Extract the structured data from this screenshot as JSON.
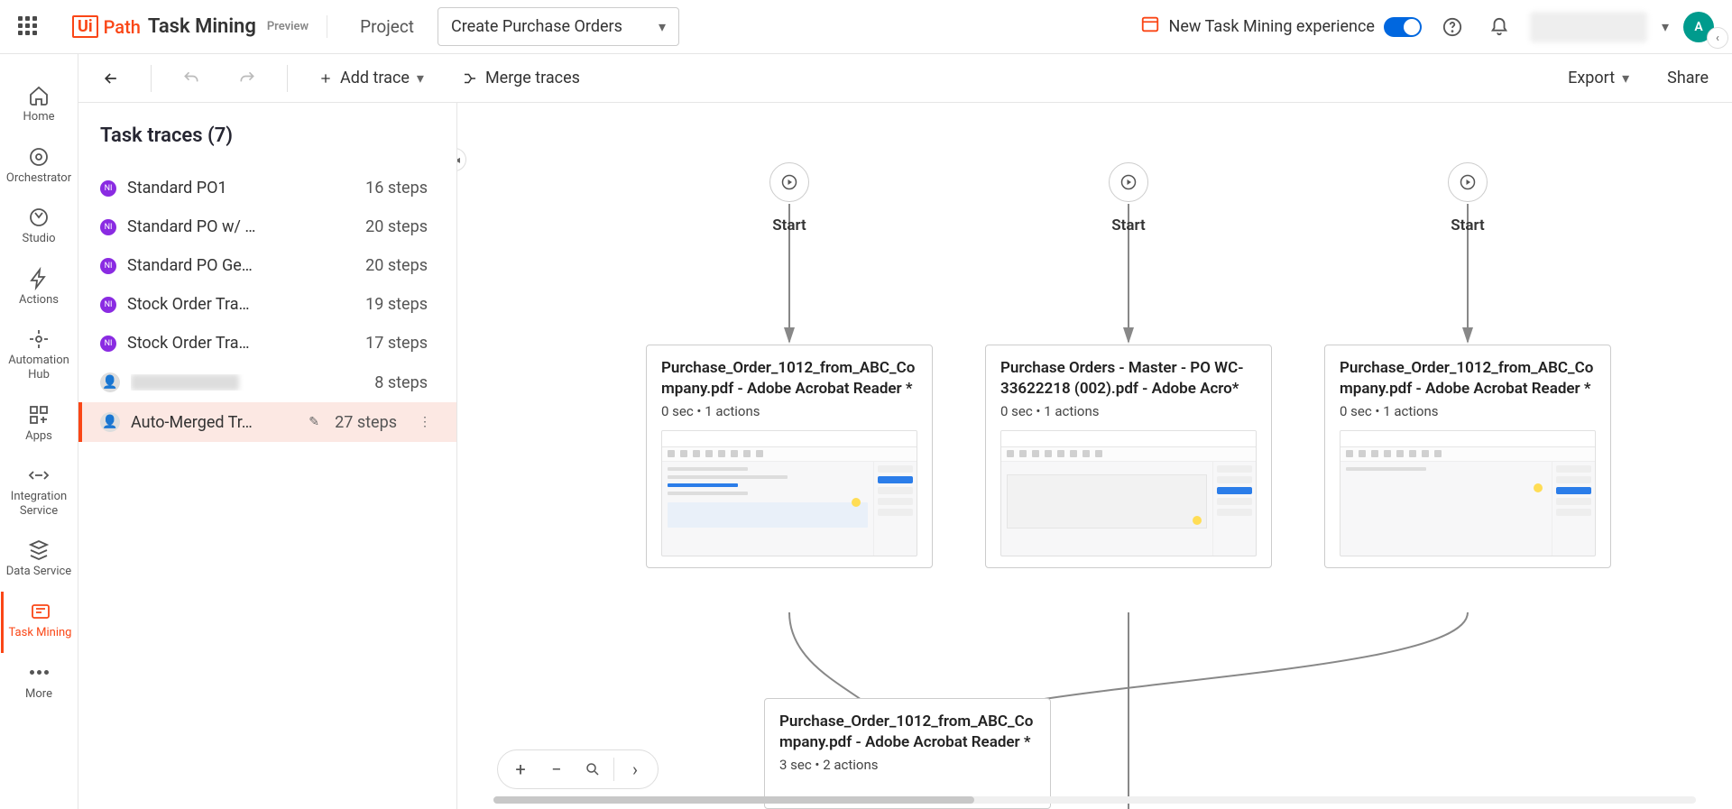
{
  "app": {
    "logo_ui": "Ui",
    "logo_path": "Path",
    "logo_product": "Task Mining",
    "preview": "Preview"
  },
  "project": {
    "label": "Project",
    "selected": "Create Purchase Orders"
  },
  "top": {
    "new_experience": "New Task Mining experience",
    "avatar_initial": "A"
  },
  "rail": {
    "home": "Home",
    "orchestrator": "Orchestrator",
    "studio": "Studio",
    "actions": "Actions",
    "automation_hub": "Automation Hub",
    "apps": "Apps",
    "integration_service": "Integration Service",
    "data_service": "Data Service",
    "task_mining": "Task Mining",
    "more": "More"
  },
  "actionbar": {
    "add_trace": "Add trace",
    "merge_traces": "Merge traces",
    "export": "Export",
    "share": "Share"
  },
  "sidebar": {
    "title": "Task traces (7)"
  },
  "traces": [
    {
      "badge": "NI",
      "name": "Standard PO1",
      "steps": "16 steps",
      "type": "initials"
    },
    {
      "badge": "NI",
      "name": "Standard PO w/ …",
      "steps": "20 steps",
      "type": "initials"
    },
    {
      "badge": "NI",
      "name": "Standard PO Ge…",
      "steps": "20 steps",
      "type": "initials"
    },
    {
      "badge": "NI",
      "name": "Stock Order Tra…",
      "steps": "19 steps",
      "type": "initials"
    },
    {
      "badge": "NI",
      "name": "Stock Order Tra…",
      "steps": "17 steps",
      "type": "initials"
    },
    {
      "badge": "",
      "name": "",
      "steps": "8 steps",
      "type": "avatar-blur"
    },
    {
      "badge": "",
      "name": "Auto-Merged Tr…",
      "steps": "27 steps",
      "type": "avatar-selected"
    }
  ],
  "flow": {
    "start_label": "Start",
    "cards": [
      {
        "title": "Purchase_Order_1012_from_ABC_Company.pdf - Adobe Acrobat Reader *",
        "meta": "0 sec • 1 actions"
      },
      {
        "title": "Purchase Orders - Master - PO WC-33622218 (002).pdf - Adobe Acro*",
        "meta": "0 sec • 1 actions"
      },
      {
        "title": "Purchase_Order_1012_from_ABC_Company.pdf - Adobe Acrobat Reader *",
        "meta": "0 sec • 1 actions"
      },
      {
        "title": "Purchase_Order_1012_from_ABC_Company.pdf - Adobe Acrobat Reader *",
        "meta": "3 sec • 2 actions"
      }
    ]
  }
}
